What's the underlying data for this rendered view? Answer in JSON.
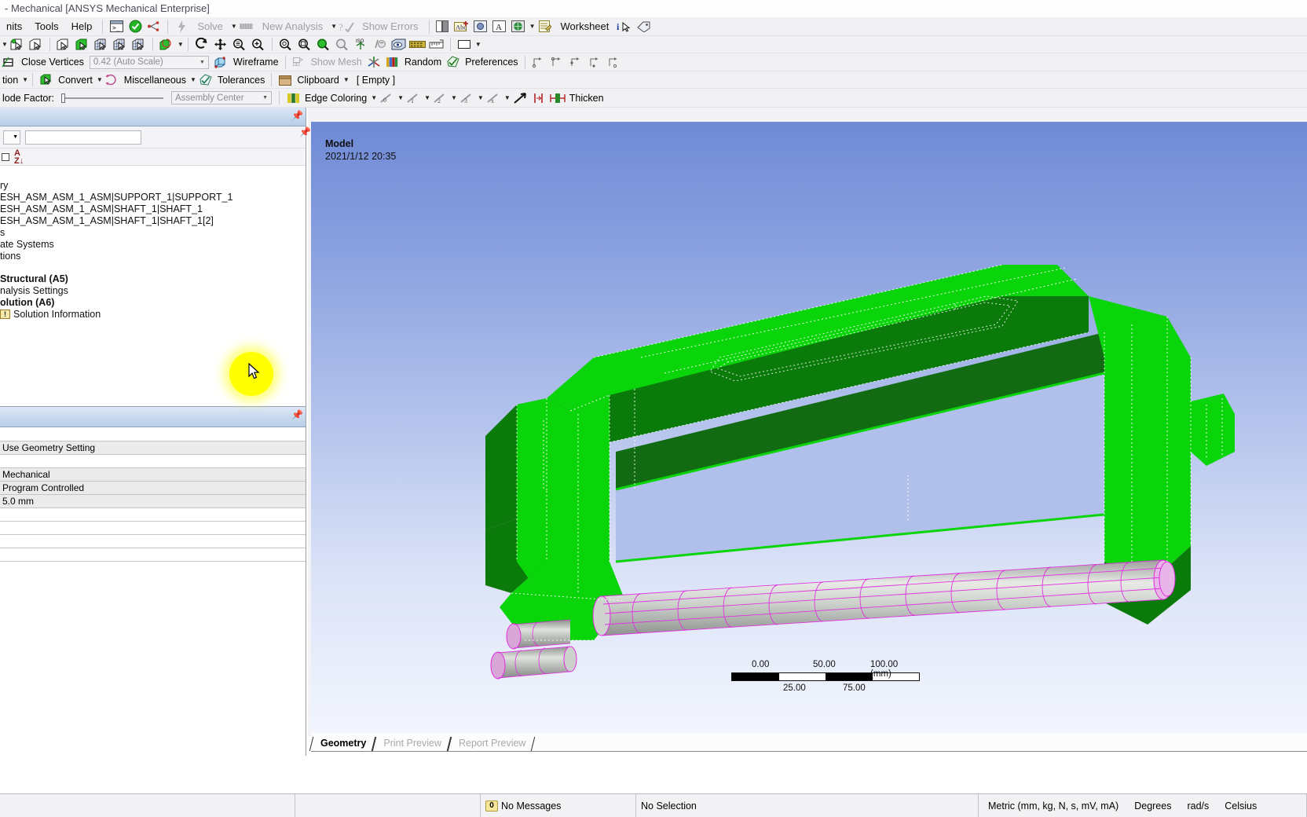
{
  "window": {
    "title": "- Mechanical [ANSYS Mechanical Enterprise]"
  },
  "menubar": {
    "items": [
      "nits",
      "Tools",
      "Help"
    ],
    "solve_label": "Solve",
    "new_analysis_label": "New Analysis",
    "show_errors_label": "Show Errors",
    "worksheet_label": "Worksheet"
  },
  "toolbar_display": {
    "close_vertices_label": "Close Vertices",
    "auto_scale_value": "0.42 (Auto Scale)",
    "wireframe_label": "Wireframe",
    "show_mesh_label": "Show Mesh",
    "random_label": "Random",
    "preferences_label": "Preferences"
  },
  "toolbar_connections": {
    "section_label": "tion",
    "convert_label": "Convert",
    "miscellaneous_label": "Miscellaneous",
    "tolerances_label": "Tolerances",
    "clipboard_label": "Clipboard",
    "clipboard_state": "[ Empty ]"
  },
  "toolbar_explode": {
    "explode_factor_label": "lode Factor:",
    "assembly_center_value": "Assembly Center",
    "edge_coloring_label": "Edge Coloring",
    "thicken_label": "Thicken"
  },
  "outline": {
    "caption": "",
    "filter_value": "",
    "tree_items": [
      {
        "label": "ry",
        "bold": false,
        "icon": false
      },
      {
        "label": "ESH_ASM_ASM_1_ASM|SUPPORT_1|SUPPORT_1",
        "bold": false,
        "icon": false
      },
      {
        "label": "ESH_ASM_ASM_1_ASM|SHAFT_1|SHAFT_1",
        "bold": false,
        "icon": false
      },
      {
        "label": "ESH_ASM_ASM_1_ASM|SHAFT_1|SHAFT_1[2]",
        "bold": false,
        "icon": false
      },
      {
        "label": "s",
        "bold": false,
        "icon": false
      },
      {
        "label": "ate Systems",
        "bold": false,
        "icon": false
      },
      {
        "label": "tions",
        "bold": false,
        "icon": false
      },
      {
        "label": "",
        "bold": false,
        "icon": false
      },
      {
        "label": "Structural (A5)",
        "bold": true,
        "icon": false
      },
      {
        "label": "nalysis Settings",
        "bold": false,
        "icon": false
      },
      {
        "label": "olution (A6)",
        "bold": true,
        "icon": false
      },
      {
        "label": "Solution Information",
        "bold": false,
        "icon": true
      }
    ]
  },
  "details": {
    "caption": "",
    "rows": [
      {
        "value": "",
        "filled": false
      },
      {
        "value": "Use Geometry Setting",
        "filled": true
      },
      {
        "value": "",
        "filled": false
      },
      {
        "value": "Mechanical",
        "filled": true
      },
      {
        "value": "Program Controlled",
        "filled": true
      },
      {
        "value": "5.0 mm",
        "filled": true
      },
      {
        "value": "",
        "filled": false
      },
      {
        "value": "",
        "filled": false
      },
      {
        "value": "",
        "filled": false
      },
      {
        "value": "",
        "filled": false
      }
    ]
  },
  "viewport": {
    "model_title": "Model",
    "model_date": "2021/1/12 20:35",
    "scale": {
      "top_labels": [
        "0.00",
        "50.00",
        "100.00 (mm)"
      ],
      "bottom_labels": [
        "25.00",
        "75.00"
      ]
    },
    "colors": {
      "body_green": "#0ad40a",
      "body_green_shadow": "#0d8a0d",
      "shaft_grey": "#c9cdc9",
      "mesh_magenta": "#e02ce0",
      "background_top": "#6f8ad6",
      "background_bottom": "#f2f5fd"
    }
  },
  "tabs": [
    {
      "label": "Geometry",
      "active": true
    },
    {
      "label": "Print Preview",
      "active": false
    },
    {
      "label": "Report Preview",
      "active": false
    }
  ],
  "statusbar": {
    "messages_count": "0",
    "messages_label": "No Messages",
    "selection_label": "No Selection",
    "unit_system": "Metric (mm, kg, N, s, mV, mA)",
    "angle_unit": "Degrees",
    "rotation_unit": "rad/s",
    "temperature_unit": "Celsius"
  }
}
